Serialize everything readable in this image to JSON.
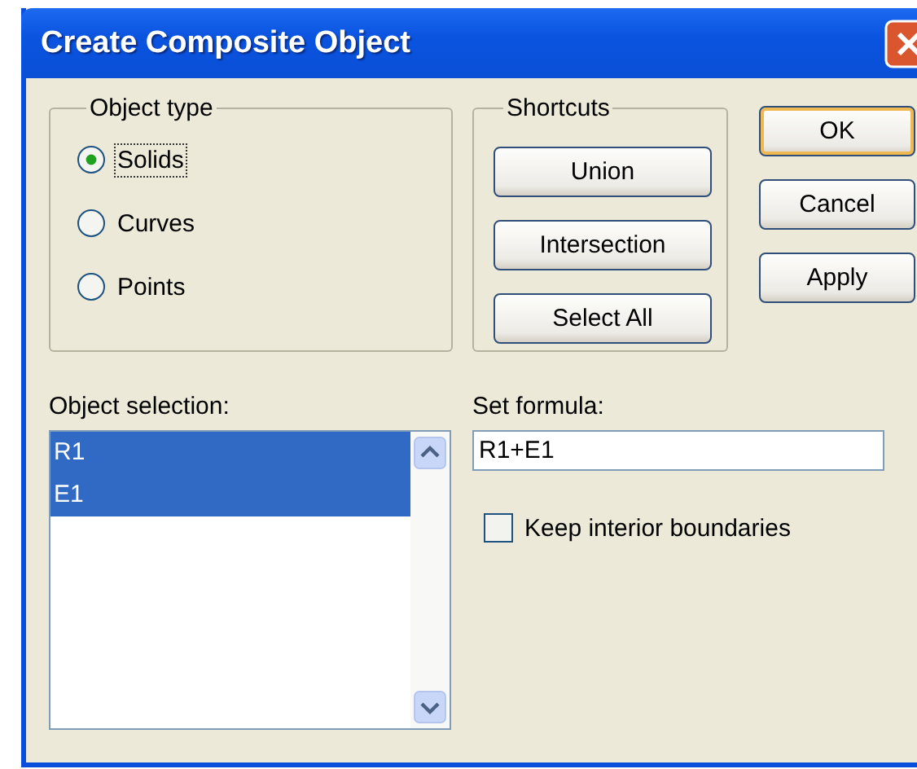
{
  "window": {
    "title": "Create Composite Object"
  },
  "object_type": {
    "label": "Object type",
    "options": [
      {
        "label": "Solids",
        "selected": true,
        "focused": true
      },
      {
        "label": "Curves",
        "selected": false,
        "focused": false
      },
      {
        "label": "Points",
        "selected": false,
        "focused": false
      }
    ]
  },
  "shortcuts": {
    "label": "Shortcuts",
    "buttons": [
      "Union",
      "Intersection",
      "Select All"
    ]
  },
  "dialog_buttons": [
    {
      "label": "OK",
      "default": true
    },
    {
      "label": "Cancel",
      "default": false
    },
    {
      "label": "Apply",
      "default": false
    }
  ],
  "object_selection": {
    "label": "Object selection:",
    "items": [
      {
        "label": "R1",
        "selected": true
      },
      {
        "label": "E1",
        "selected": true
      }
    ]
  },
  "set_formula": {
    "label": "Set formula:",
    "value": "R1+E1"
  },
  "keep_interior_boundaries": {
    "label": "Keep interior boundaries",
    "checked": false
  }
}
